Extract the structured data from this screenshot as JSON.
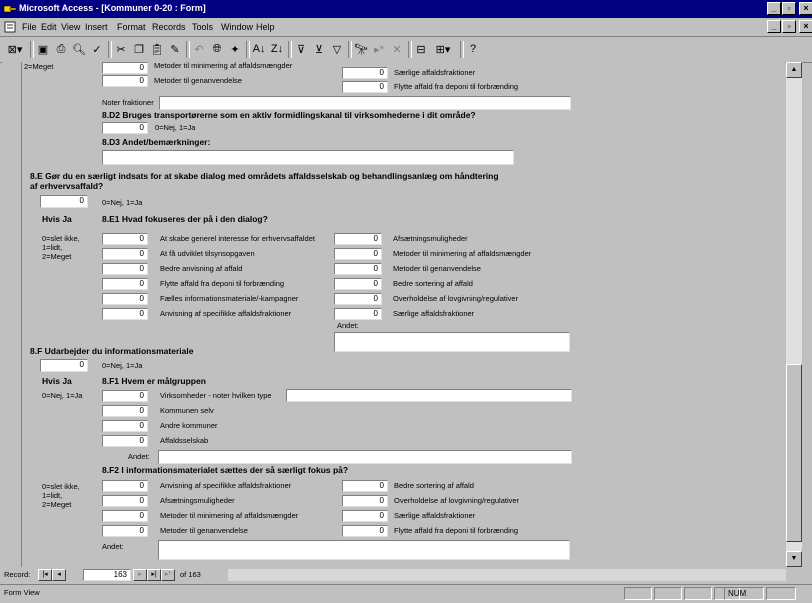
{
  "window": {
    "title": "Microsoft Access - [Kommuner 0-20 : Form]"
  },
  "menu": [
    "File",
    "Edit",
    "View",
    "Insert",
    "Format",
    "Records",
    "Tools",
    "Window",
    "Help"
  ],
  "form": {
    "top_cut_note": "2=Meget",
    "top_left": [
      {
        "value": "0",
        "label": "Metoder til minimering af affaldsmængder"
      },
      {
        "value": "0",
        "label": "Metoder til genanvendelse"
      }
    ],
    "top_right": [
      {
        "value": "0",
        "label": "Særlige affaldsfraktioner"
      },
      {
        "value": "0",
        "label": "Flytte affald fra deponi til forbrænding"
      }
    ],
    "noter_label": "Noter fraktioner",
    "d2_heading": "8.D2 Bruges transportørerne som en aktiv formidlingskanal til virksomhederne i dit område?",
    "d2_value": "0",
    "d2_hint": "0=Nej, 1=Ja",
    "d3_heading": "8.D3 Andet/bemærkninger:",
    "e_heading_1": "8.E Gør du en særligt indsats for at skabe dialog med områdets affaldsselskab og behandlingsanlæg om håndtering",
    "e_heading_2": "af erhvervsaffald?",
    "e_value": "0",
    "e_hint": "0=Nej, 1=Ja",
    "hvis_ja": "Hvis Ja",
    "e1_heading": "8.E1 Hvad fokuseres der på i den dialog?",
    "scale_note": [
      "0=slet ikke,",
      "1=lidt,",
      "2=Meget"
    ],
    "e1_left": [
      {
        "value": "0",
        "label": "At skabe generel interesse for erhvervsaffaldet"
      },
      {
        "value": "0",
        "label": "At få udviklet tilsynsopgaven"
      },
      {
        "value": "0",
        "label": "Bedre anvisning af affald"
      },
      {
        "value": "0",
        "label": "Flytte affald fra deponi til forbrænding"
      },
      {
        "value": "0",
        "label": "Fælles informationsmateriale/-kampagner"
      },
      {
        "value": "0",
        "label": "Anvisning af specifikke affaldsfraktioner"
      }
    ],
    "e1_right": [
      {
        "value": "0",
        "label": "Afsætningsmuligheder"
      },
      {
        "value": "0",
        "label": "Metoder til minimering af affaldsmængder"
      },
      {
        "value": "0",
        "label": "Metoder til genanvendelse"
      },
      {
        "value": "0",
        "label": "Bedre sortering af affald"
      },
      {
        "value": "0",
        "label": "Overholdelse af lovgivning/regulativer"
      },
      {
        "value": "0",
        "label": "Særlige affaldsfraktioner"
      }
    ],
    "andet_label": "Andet:",
    "f_heading": "8.F Udarbejder du informationsmateriale",
    "f_value": "0",
    "f_hint": "0=Nej, 1=Ja",
    "f1_heading": "8.F1 Hvem er målgruppen",
    "f1_hint": "0=Nej, 1=Ja",
    "f1_items": [
      {
        "value": "0",
        "label": "Virksomheder - noter hvilken type"
      },
      {
        "value": "0",
        "label": "Kommunen selv"
      },
      {
        "value": "0",
        "label": "Andre kommuner"
      },
      {
        "value": "0",
        "label": "Affaldsselskab"
      }
    ],
    "f2_heading": "8.F2 I informationsmaterialet sættes der så særligt fokus på?",
    "f2_left": [
      {
        "value": "0",
        "label": "Anvisning af specifikke affaldsfraktioner"
      },
      {
        "value": "0",
        "label": "Afsætningsmuligheder"
      },
      {
        "value": "0",
        "label": "Metoder til minimering af affaldsmængder"
      },
      {
        "value": "0",
        "label": "Metoder til genanvendelse"
      }
    ],
    "f2_right": [
      {
        "value": "0",
        "label": "Bedre sortering af affald"
      },
      {
        "value": "0",
        "label": "Overholdelse af lovgivning/regulativer"
      },
      {
        "value": "0",
        "label": "Særlige affaldsfraktioner"
      },
      {
        "value": "0",
        "label": "Flytte affald fra deponi til forbrænding"
      }
    ]
  },
  "record_nav": {
    "label": "Record:",
    "current": "163",
    "of_text": "of 163"
  },
  "status": {
    "mode": "Form View",
    "num": "NUM"
  }
}
